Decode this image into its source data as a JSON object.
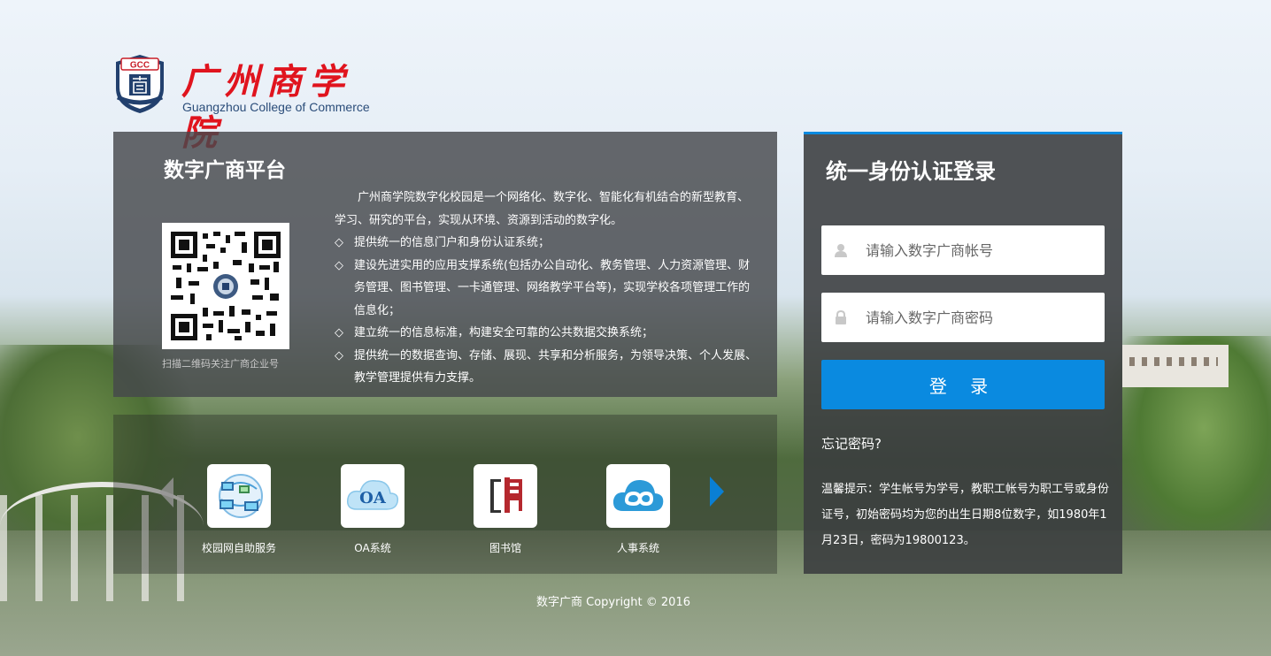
{
  "logo": {
    "badge_text": "GCC",
    "name_cn": "广州商学院",
    "name_en": "Guangzhou College of Commerce"
  },
  "info": {
    "title": "数字广商平台",
    "qr_caption": "扫描二维码关注广商企业号",
    "intro": "广州商学院数字化校园是一个网络化、数字化、智能化有机结合的新型教育、学习、研究的平台，实现从环境、资源到活动的数字化。",
    "bullet_mark": "◇",
    "bullets": [
      "提供统一的信息门户和身份认证系统；",
      "建设先进实用的应用支撑系统(包括办公自动化、教务管理、人力资源管理、财务管理、图书管理、一卡通管理、网络教学平台等)，实现学校各项管理工作的信息化；",
      "建立统一的信息标准，构建安全可靠的公共数据交换系统；",
      "提供统一的数据查询、存储、展现、共享和分析服务，为领导决策、个人发展、教学管理提供有力支撑。"
    ]
  },
  "apps": [
    {
      "label": "校园网自助服务",
      "icon": "network-computers-icon"
    },
    {
      "label": "OA系统",
      "icon": "oa-cloud-icon",
      "icon_text": "OA"
    },
    {
      "label": "图书馆",
      "icon": "library-icon"
    },
    {
      "label": "人事系统",
      "icon": "hr-cloud-icon"
    }
  ],
  "login": {
    "title": "统一身份认证登录",
    "username_placeholder": "请输入数字广商帐号",
    "password_placeholder": "请输入数字广商密码",
    "submit_label": "登 录",
    "forgot_label": "忘记密码?",
    "tip": "温馨提示：学生帐号为学号，教职工帐号为职工号或身份证号，初始密码均为您的出生日期8位数字，如1980年1月23日，密码为19800123。"
  },
  "footer": {
    "copyright": "数字广商 Copyright © 2016"
  },
  "colors": {
    "accent": "#0a8ae0",
    "logo_red": "#e0141e",
    "logo_blue": "#2b4d7a"
  }
}
